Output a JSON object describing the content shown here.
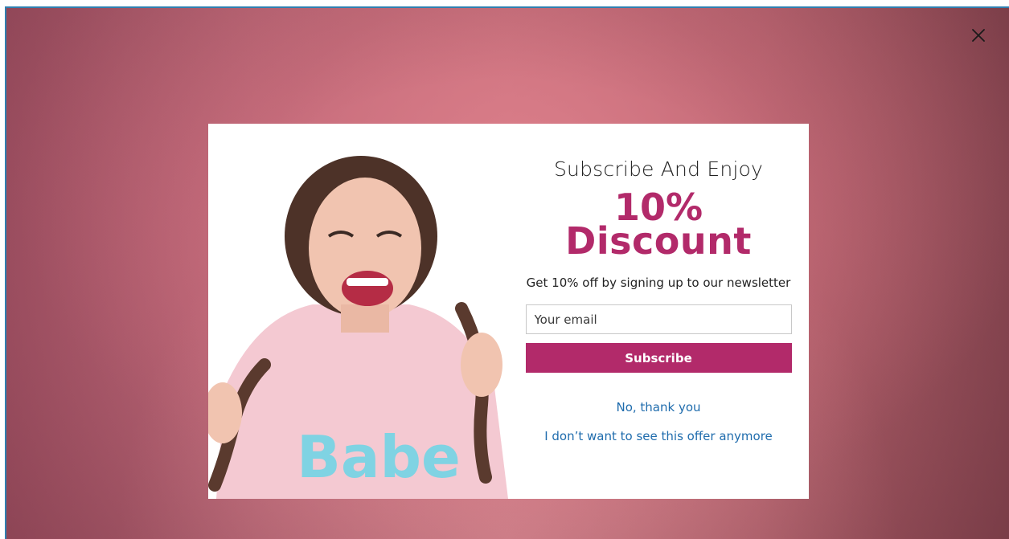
{
  "popup": {
    "heading": "Subscribe And Enjoy",
    "offer_line1": "10%",
    "offer_line2": "Discount",
    "description": "Get 10% off by signing up to our newsletter",
    "email_placeholder": "Your email",
    "subscribe_label": "Subscribe",
    "decline_label": "No, thank you",
    "never_label": "I don’t want to see this offer anymore",
    "photo_shirt_text": "Babe"
  },
  "icons": {
    "close": "close-icon"
  },
  "colors": {
    "accent": "#b22a6a",
    "link": "#1f6cad",
    "background": "#c06a7a"
  }
}
